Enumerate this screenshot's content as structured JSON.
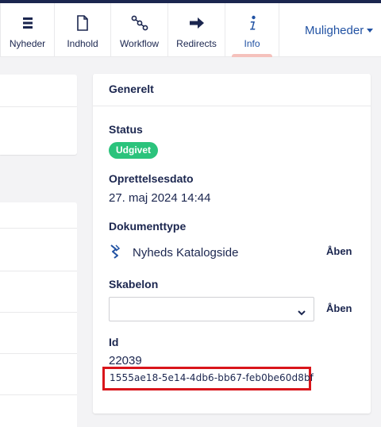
{
  "tabs": [
    {
      "label": "Nyheder",
      "icon": "list-icon"
    },
    {
      "label": "Indhold",
      "icon": "document-icon"
    },
    {
      "label": "Workflow",
      "icon": "workflow-icon"
    },
    {
      "label": "Redirects",
      "icon": "arrow-right-icon"
    },
    {
      "label": "Info",
      "icon": "info-icon",
      "active": true
    }
  ],
  "more_label": "Muligheder",
  "card": {
    "title": "Generelt",
    "status_label": "Status",
    "status_badge": "Udgivet",
    "created_label": "Oprettelsesdato",
    "created_value": "27. maj 2024 14:44",
    "doctype_label": "Dokumenttype",
    "doctype_value": "Nyheds Katalogside",
    "doctype_open": "Åben",
    "template_label": "Skabelon",
    "template_value": "",
    "template_open": "Åben",
    "id_label": "Id",
    "id_value": "22039",
    "guid_value": "1555ae18-5e14-4db6-bb67-feb0be60d8bf"
  },
  "colors": {
    "accent": "#2152a3",
    "navy": "#1b264f",
    "badge_green": "#2bc37c",
    "highlight_red": "#d9151b",
    "active_underline": "#f5c1bc"
  }
}
